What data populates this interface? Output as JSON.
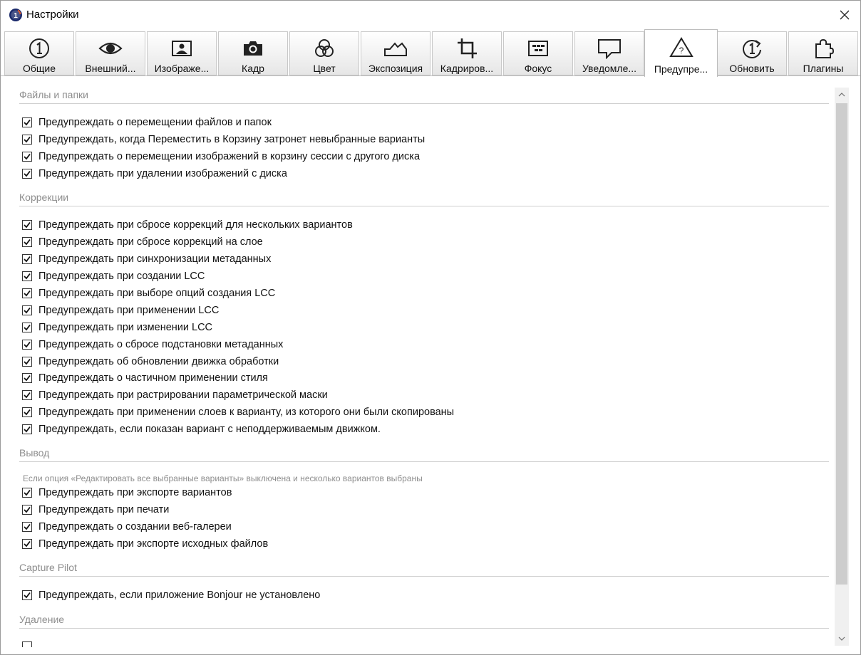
{
  "window": {
    "title": "Настройки"
  },
  "tabs": [
    {
      "label": "Общие",
      "icon": "general-icon"
    },
    {
      "label": "Внешний...",
      "icon": "eye-icon"
    },
    {
      "label": "Изображе...",
      "icon": "image-icon"
    },
    {
      "label": "Кадр",
      "icon": "camera-icon"
    },
    {
      "label": "Цвет",
      "icon": "color-circles-icon"
    },
    {
      "label": "Экспозиция",
      "icon": "exposure-icon"
    },
    {
      "label": "Кадриров...",
      "icon": "crop-icon"
    },
    {
      "label": "Фокус",
      "icon": "focus-icon"
    },
    {
      "label": "Уведомле...",
      "icon": "speech-bubble-icon"
    },
    {
      "label": "Предупре...",
      "icon": "warning-icon",
      "active": true
    },
    {
      "label": "Обновить",
      "icon": "update-icon"
    },
    {
      "label": "Плагины",
      "icon": "puzzle-icon"
    }
  ],
  "sections": {
    "files": {
      "title": "Файлы и папки",
      "items": [
        {
          "label": "Предупреждать о перемещении файлов и папок",
          "checked": true
        },
        {
          "label": "Предупреждать, когда Переместить в Корзину затронет невыбранные варианты",
          "checked": true
        },
        {
          "label": "Предупреждать о перемещении изображений в корзину сессии с другого диска",
          "checked": true
        },
        {
          "label": "Предупреждать при удалении изображений с диска",
          "checked": true
        }
      ]
    },
    "corrections": {
      "title": "Коррекции",
      "items": [
        {
          "label": "Предупреждать при сбросе коррекций для нескольких вариантов",
          "checked": true
        },
        {
          "label": "Предупреждать при сбросе коррекций на слое",
          "checked": true
        },
        {
          "label": "Предупреждать при синхронизации метаданных",
          "checked": true
        },
        {
          "label": "Предупреждать при создании LCC",
          "checked": true
        },
        {
          "label": "Предупреждать при выборе опций создания LCC",
          "checked": true
        },
        {
          "label": "Предупреждать при применении LCC",
          "checked": true
        },
        {
          "label": "Предупреждать при изменении LCC",
          "checked": true
        },
        {
          "label": "Предупреждать о сбросе подстановки метаданных",
          "checked": true
        },
        {
          "label": "Предупреждать об обновлении движка обработки",
          "checked": true
        },
        {
          "label": "Предупреждать о частичном применении стиля",
          "checked": true
        },
        {
          "label": "Предупреждать при растрировании параметрической маски",
          "checked": true
        },
        {
          "label": "Предупреждать при применении слоев к варианту, из которого они были скопированы",
          "checked": true
        },
        {
          "label": "Предупреждать, если показан вариант с неподдерживаемым движком.",
          "checked": true
        }
      ]
    },
    "output": {
      "title": "Вывод",
      "note": "Если опция «Редактировать все выбранные варианты» выключена и несколько вариантов выбраны",
      "items": [
        {
          "label": "Предупреждать при экспорте вариантов",
          "checked": true
        },
        {
          "label": "Предупреждать при печати",
          "checked": true
        },
        {
          "label": "Предупреждать о создании веб-галереи",
          "checked": true
        },
        {
          "label": "Предупреждать при экспорте исходных файлов",
          "checked": true
        }
      ]
    },
    "capture_pilot": {
      "title": "Capture Pilot",
      "items": [
        {
          "label": "Предупреждать, если приложение Bonjour не установлено",
          "checked": true
        }
      ]
    },
    "deletion": {
      "title": "Удаление"
    }
  },
  "colors": {
    "section_header": "#8d8d8d",
    "scroll_thumb": "#cdcdcd",
    "app_icon_blue": "#1b2a6b"
  }
}
